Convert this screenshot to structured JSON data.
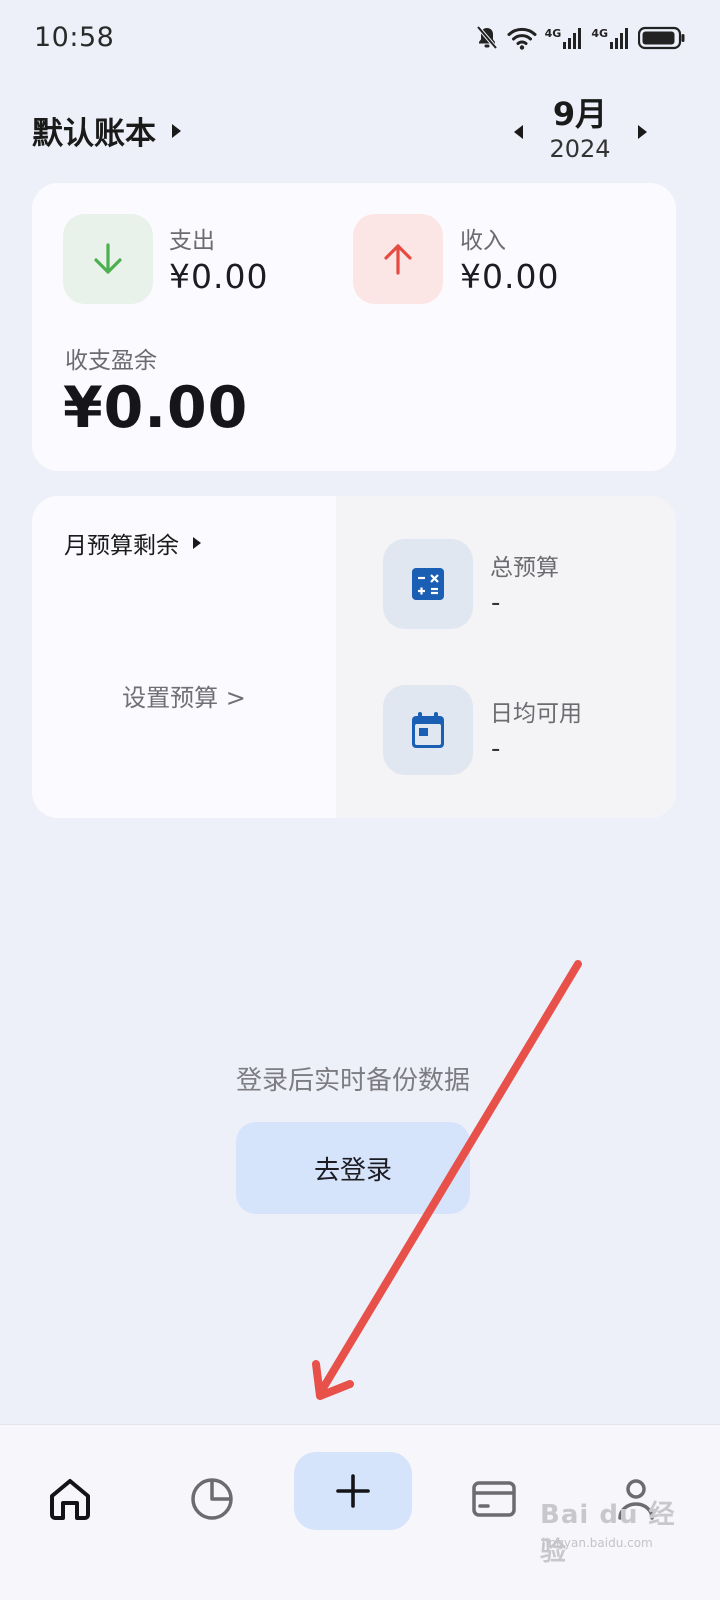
{
  "status_bar": {
    "time": "10:58",
    "network_1": "4G",
    "network_2": "4G"
  },
  "header": {
    "book_name": "默认账本",
    "month": "9月",
    "year": "2024"
  },
  "summary": {
    "expense_label": "支出",
    "expense_value": "¥0.00",
    "income_label": "收入",
    "income_value": "¥0.00",
    "balance_label": "收支盈余",
    "balance_value": "¥0.00",
    "colors": {
      "expense": "#4caf50",
      "income": "#e54b40"
    }
  },
  "budget": {
    "title": "月预算剩余",
    "set_budget_link": "设置预算 >",
    "total_label": "总预算",
    "total_value": "-",
    "daily_label": "日均可用",
    "daily_value": "-",
    "icon_color": "#1a5fb4"
  },
  "login": {
    "hint": "登录后实时备份数据",
    "button_label": "去登录"
  },
  "bottom_nav": {
    "items": [
      "home-icon",
      "chart-pie-icon",
      "plus-icon",
      "card-icon",
      "person-icon"
    ],
    "accent": "#d5e3fb"
  },
  "watermark": {
    "text": "Bai du 经验",
    "sub": "jingyan.baidu.com"
  }
}
